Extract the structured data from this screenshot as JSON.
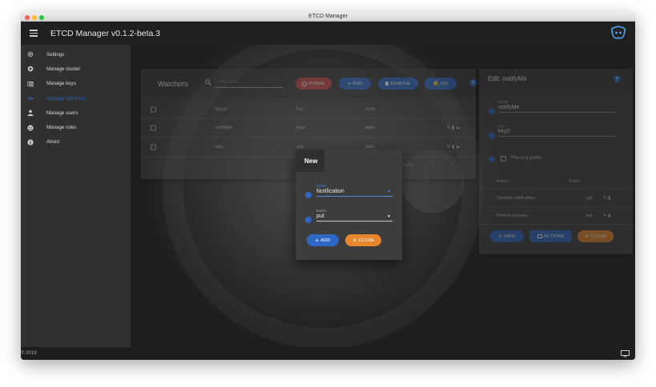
{
  "window": {
    "title": "ETCD Manager"
  },
  "appbar": {
    "title": "ETCD Manager v0.1.2-beta.3"
  },
  "sidebar": {
    "items": [
      {
        "label": "Settings",
        "icon": "gear-icon"
      },
      {
        "label": "Manage cluster",
        "icon": "cluster-icon"
      },
      {
        "label": "Manage keys",
        "icon": "list-icon"
      },
      {
        "label": "Manage watchers",
        "icon": "eye-icon",
        "active": true
      },
      {
        "label": "Manage users",
        "icon": "user-icon"
      },
      {
        "label": "Manage roles",
        "icon": "roles-icon"
      },
      {
        "label": "About",
        "icon": "info-icon"
      }
    ]
  },
  "watchers": {
    "title": "Watchers",
    "filter_placeholder": "Filter data...",
    "purge_label": "PURGE",
    "add_label": "ADD",
    "remove_label": "REMOVE",
    "on_label": "ON",
    "columns": {
      "name": "Name",
      "key": "Key",
      "prefix": "Prefix"
    },
    "rows": [
      {
        "name": "notifyMe",
        "key": "key2",
        "prefix": "false"
      },
      {
        "name": "test",
        "key": "test",
        "prefix": "false"
      }
    ],
    "pagination": "1-2 of 2"
  },
  "edit": {
    "title": "Edit: notifyMe",
    "name_label": "Name",
    "name_value": "notifyMe",
    "key_label": "Key",
    "key_value": "key2",
    "prefix_label": "This is a prefix",
    "columns": {
      "action": "Action",
      "event": "Event"
    },
    "rows": [
      {
        "action": "Desktop notification",
        "event": "put"
      },
      {
        "action": "Print to console",
        "event": "put"
      }
    ],
    "save_label": "SAVE",
    "actions_label": "ACTIONS",
    "close_label": "CLOSE"
  },
  "dialog": {
    "title": "New",
    "action_label": "Action",
    "action_value": "Notification",
    "event_label": "Event",
    "event_value": "put",
    "add_label": "ADD",
    "close_label": "CLOSE"
  },
  "footer": {
    "copyright": "© 2019"
  },
  "colors": {
    "primary": "#2f68c4",
    "danger": "#c84848",
    "warning": "#e8862c",
    "active": "#2f64b0"
  }
}
